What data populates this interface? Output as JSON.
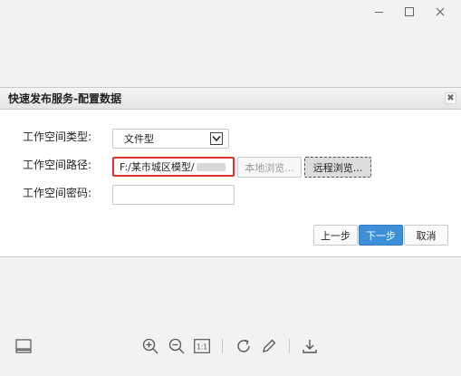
{
  "dialog": {
    "title": "快速发布服务-配置数据",
    "close_glyph": "✖"
  },
  "form": {
    "workspace_type_label": "工作空间类型:",
    "workspace_type_value": "文件型",
    "workspace_path_label": "工作空间路径:",
    "workspace_path_value": "F:/某市城区模型/",
    "workspace_password_label": "工作空间密码:",
    "workspace_password_value": ""
  },
  "buttons": {
    "local_browse": "本地浏览...",
    "remote_browse": "远程浏览...",
    "previous": "上一步",
    "next": "下一步",
    "cancel": "取消"
  },
  "colors": {
    "primary": "#3d8fd8",
    "highlight_border": "#e03030"
  },
  "toolbar_icons": [
    "layout-icon",
    "zoom-in-icon",
    "zoom-out-icon",
    "actual-size-icon",
    "rotate-icon",
    "edit-icon",
    "download-icon"
  ],
  "toolbar": {
    "actual_size_label": "1:1"
  }
}
